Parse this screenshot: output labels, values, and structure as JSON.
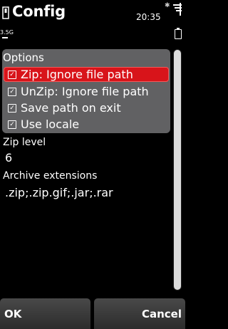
{
  "titlebar": {
    "title": "Config",
    "time": "20:35",
    "network": "3.5G",
    "bluetooth_icon": "bluetooth-icon",
    "antenna_icon": "antenna-icon",
    "battery_icon": "battery-icon"
  },
  "options": {
    "title": "Options",
    "items": [
      {
        "label": "Zip: Ignore file path",
        "checked": true,
        "selected": true
      },
      {
        "label": "UnZip: Ignore file path",
        "checked": true,
        "selected": false
      },
      {
        "label": "Save path on exit",
        "checked": true,
        "selected": false
      },
      {
        "label": "Use locale",
        "checked": true,
        "selected": false
      }
    ]
  },
  "zip_level": {
    "label": "Zip level",
    "value": "6"
  },
  "archive_extensions": {
    "label": "Archive extensions",
    "value": ".zip;.zip.gif;.jar;.rar"
  },
  "softkeys": {
    "left": "OK",
    "right": "Cancel"
  },
  "colors": {
    "highlight": "#d8141a",
    "panel": "#616163",
    "background": "#000000"
  }
}
